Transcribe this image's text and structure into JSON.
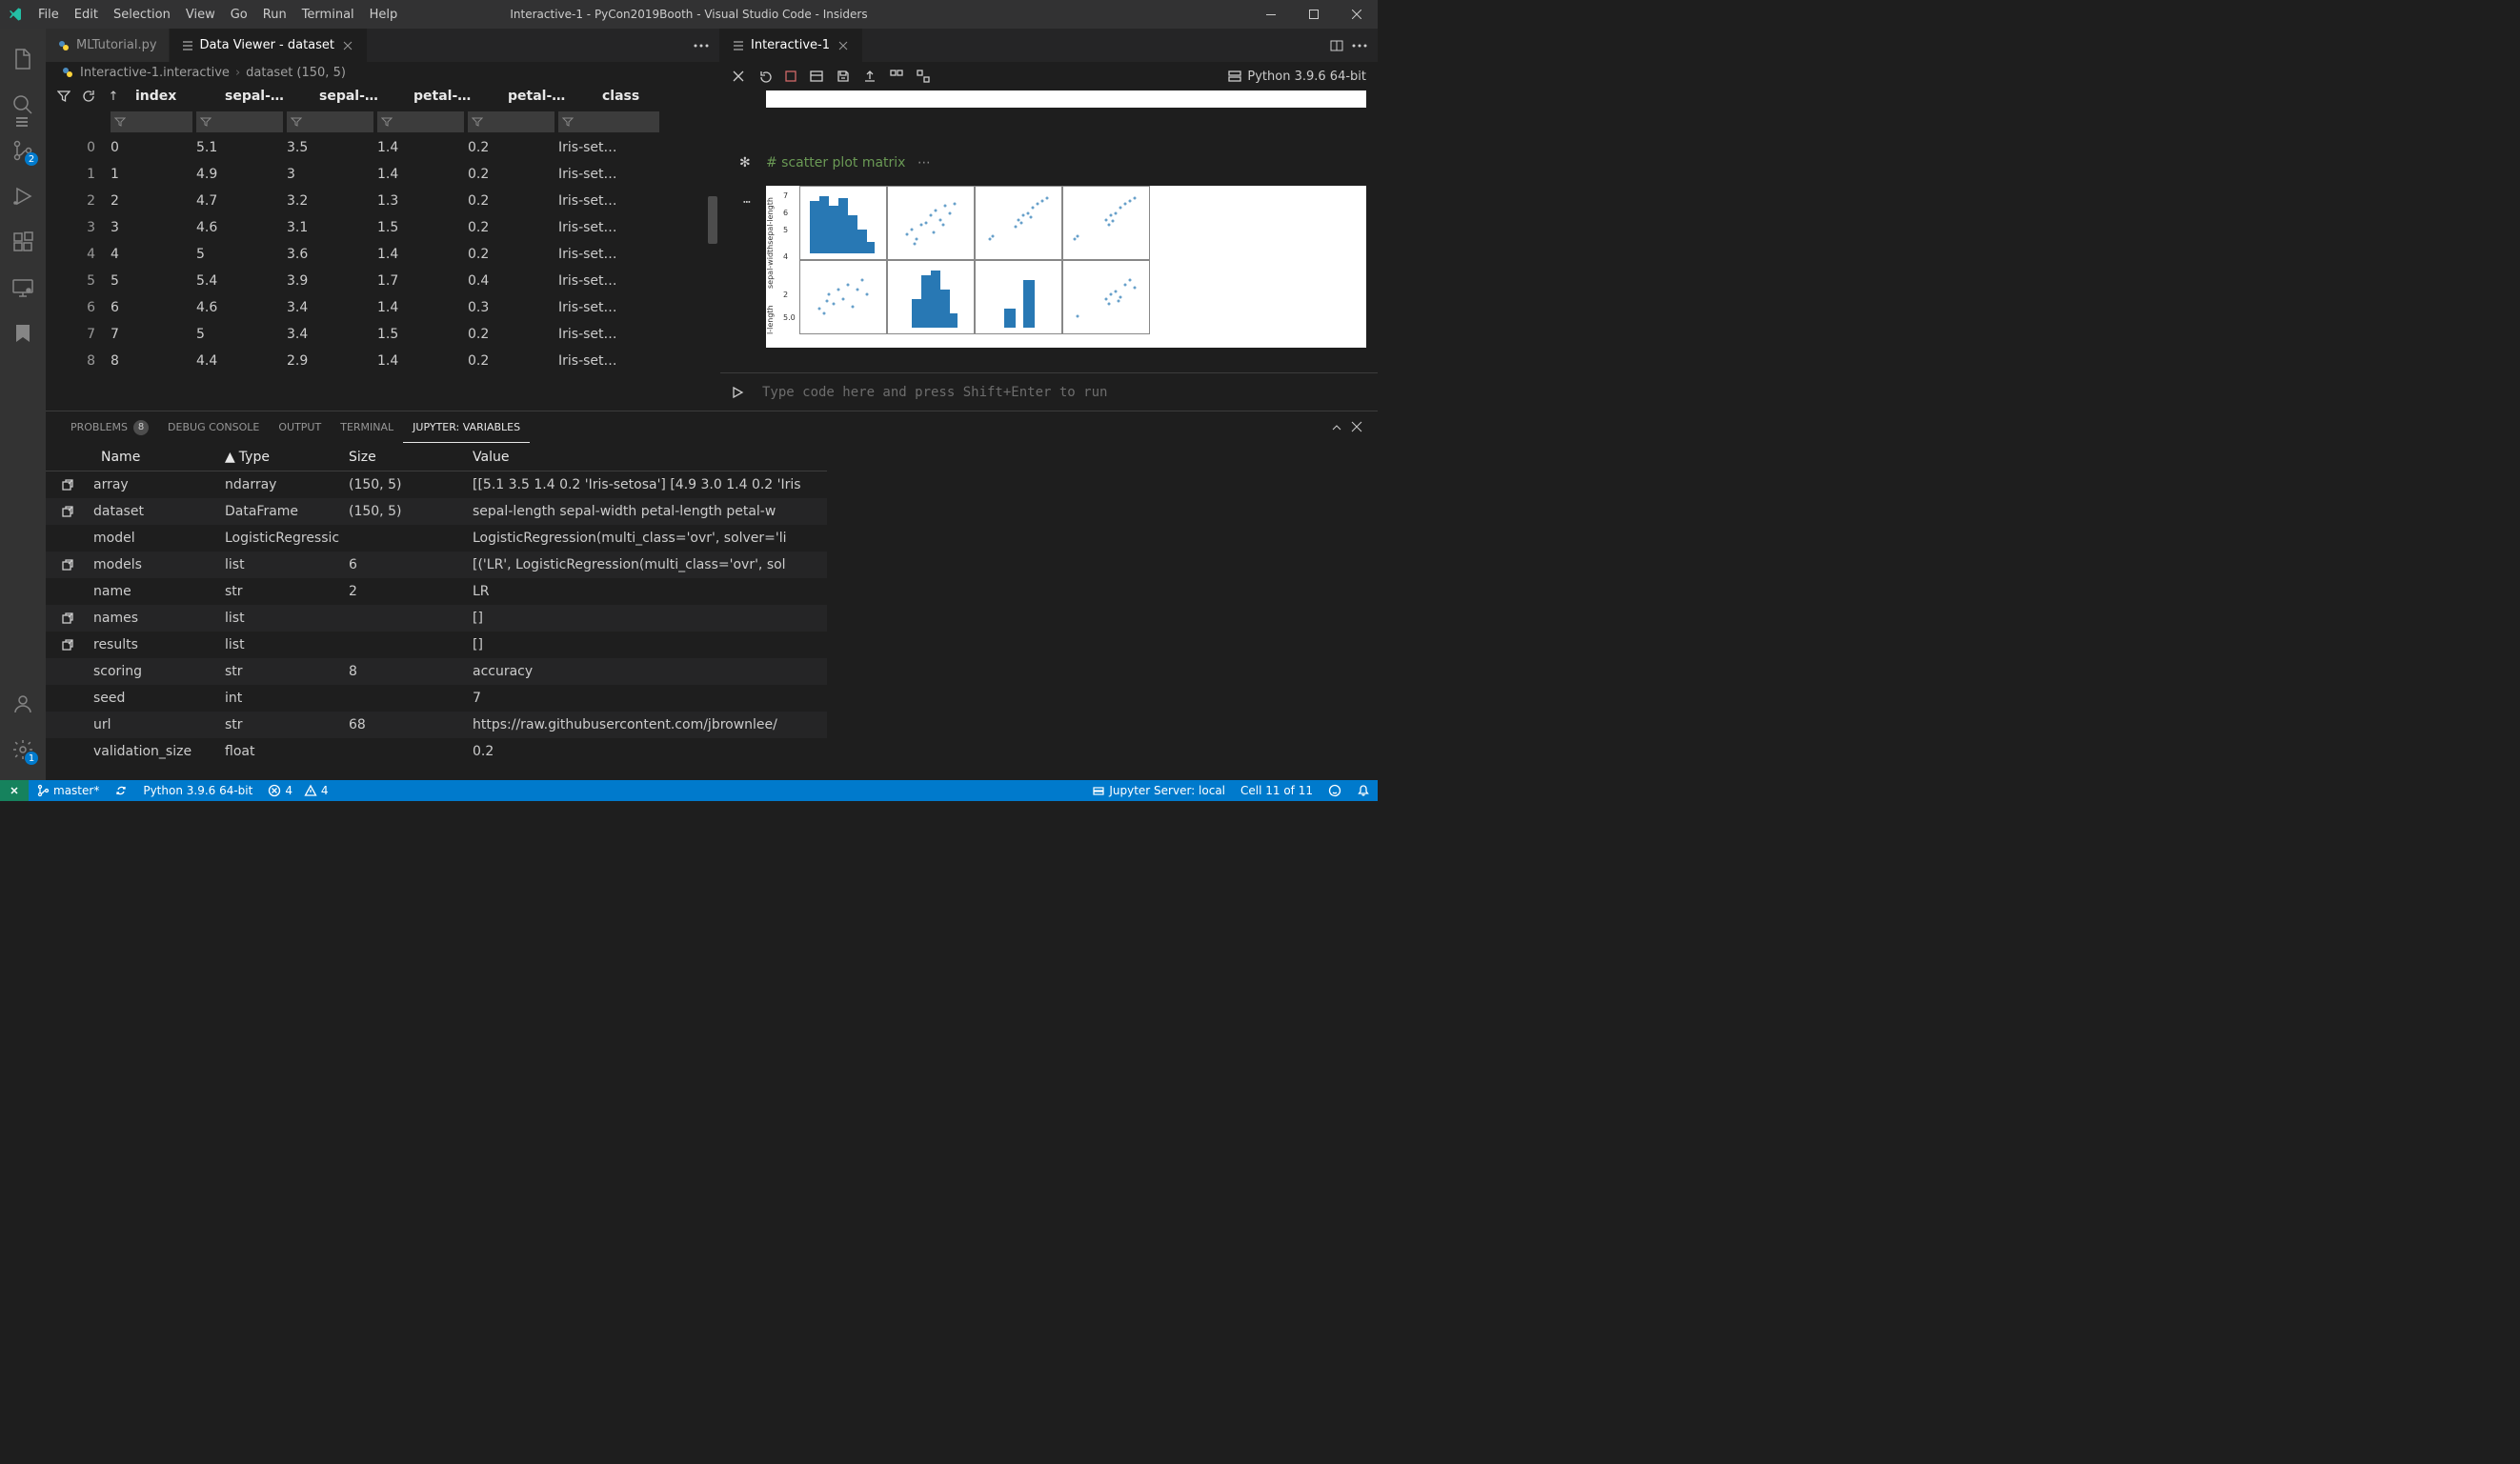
{
  "window": {
    "title": "Interactive-1 - PyCon2019Booth - Visual Studio Code - Insiders"
  },
  "menu": [
    "File",
    "Edit",
    "Selection",
    "View",
    "Go",
    "Run",
    "Terminal",
    "Help"
  ],
  "activity": {
    "scm_badge": "2",
    "settings_badge": "1"
  },
  "tabs_left": [
    {
      "label": "MLTutorial.py",
      "active": false
    },
    {
      "label": "Data Viewer - dataset",
      "active": true
    }
  ],
  "tabs_right": [
    {
      "label": "Interactive-1",
      "active": true
    }
  ],
  "breadcrumb": {
    "a": "Interactive-1.interactive",
    "b": "dataset (150, 5)"
  },
  "data_viewer": {
    "columns": [
      "index",
      "sepal-…",
      "sepal-…",
      "petal-…",
      "petal-…",
      "class"
    ],
    "rows": [
      [
        "0",
        "0",
        "5.1",
        "3.5",
        "1.4",
        "0.2",
        "Iris-set…"
      ],
      [
        "1",
        "1",
        "4.9",
        "3",
        "1.4",
        "0.2",
        "Iris-set…"
      ],
      [
        "2",
        "2",
        "4.7",
        "3.2",
        "1.3",
        "0.2",
        "Iris-set…"
      ],
      [
        "3",
        "3",
        "4.6",
        "3.1",
        "1.5",
        "0.2",
        "Iris-set…"
      ],
      [
        "4",
        "4",
        "5",
        "3.6",
        "1.4",
        "0.2",
        "Iris-set…"
      ],
      [
        "5",
        "5",
        "5.4",
        "3.9",
        "1.7",
        "0.4",
        "Iris-set…"
      ],
      [
        "6",
        "6",
        "4.6",
        "3.4",
        "1.4",
        "0.3",
        "Iris-set…"
      ],
      [
        "7",
        "7",
        "5",
        "3.4",
        "1.5",
        "0.2",
        "Iris-set…"
      ],
      [
        "8",
        "8",
        "4.4",
        "2.9",
        "1.4",
        "0.2",
        "Iris-set…"
      ]
    ]
  },
  "interactive": {
    "python_label": "Python 3.9.6 64-bit",
    "code_comment": "# scatter plot matrix",
    "input_placeholder": "Type code here and press Shift+Enter to run",
    "tick_labels_left": [
      "7",
      "6",
      "5",
      "4",
      "2",
      "5.0"
    ]
  },
  "panel": {
    "tabs": [
      {
        "label": "PROBLEMS",
        "badge": "8"
      },
      {
        "label": "DEBUG CONSOLE"
      },
      {
        "label": "OUTPUT"
      },
      {
        "label": "TERMINAL"
      },
      {
        "label": "JUPYTER: VARIABLES",
        "active": true
      }
    ],
    "headers": {
      "name": "Name",
      "type": "Type",
      "size": "Size",
      "value": "Value",
      "sort": "▲"
    },
    "rows": [
      {
        "pop": true,
        "name": "array",
        "type": "ndarray",
        "size": "(150, 5)",
        "value": "[[5.1 3.5 1.4 0.2 'Iris-setosa'] [4.9 3.0 1.4 0.2 'Iris"
      },
      {
        "pop": true,
        "name": "dataset",
        "type": "DataFrame",
        "size": "(150, 5)",
        "value": "sepal-length sepal-width petal-length petal-w"
      },
      {
        "pop": false,
        "name": "model",
        "type": "LogisticRegressic",
        "size": "",
        "value": "LogisticRegression(multi_class='ovr', solver='li"
      },
      {
        "pop": true,
        "name": "models",
        "type": "list",
        "size": "6",
        "value": "[('LR', LogisticRegression(multi_class='ovr', sol"
      },
      {
        "pop": false,
        "name": "name",
        "type": "str",
        "size": "2",
        "value": "LR"
      },
      {
        "pop": true,
        "name": "names",
        "type": "list",
        "size": "",
        "value": "[]"
      },
      {
        "pop": true,
        "name": "results",
        "type": "list",
        "size": "",
        "value": "[]"
      },
      {
        "pop": false,
        "name": "scoring",
        "type": "str",
        "size": "8",
        "value": "accuracy"
      },
      {
        "pop": false,
        "name": "seed",
        "type": "int",
        "size": "",
        "value": "7"
      },
      {
        "pop": false,
        "name": "url",
        "type": "str",
        "size": "68",
        "value": "https://raw.githubusercontent.com/jbrownlee/"
      },
      {
        "pop": false,
        "name": "validation_size",
        "type": "float",
        "size": "",
        "value": "0.2"
      }
    ]
  },
  "statusbar": {
    "branch": "master*",
    "python": "Python 3.9.6 64-bit",
    "errors": "4",
    "warnings": "4",
    "jupyter": "Jupyter Server: local",
    "cell": "Cell 11 of 11"
  }
}
